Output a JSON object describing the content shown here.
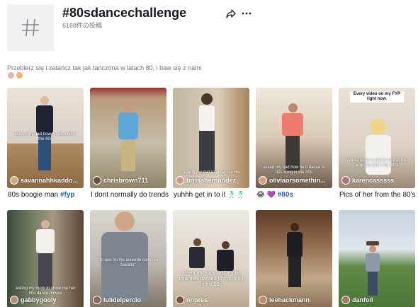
{
  "header": {
    "title": "#80sdancechallenge",
    "post_count": "6168件の投稿",
    "icons": {
      "hashtag": "hashtag-icon",
      "share": "share-icon",
      "more": "more-icon"
    }
  },
  "description": {
    "text": "Przebierz się i zatańcz tak jak tańczona w latach 80, i baw się z nami"
  },
  "videos": [
    {
      "author": "savannahhkaddo...",
      "overlay": "asking my dad how he danced in the 80s",
      "caption": "80s boogie man ",
      "caption_tag": "#fyp"
    },
    {
      "author": "chrisbrown711",
      "overlay": "",
      "caption": "I dont normally do trends",
      "caption_tag": ""
    },
    {
      "author": "brrisahernandez",
      "overlay": "asking my dad to show me his",
      "caption": "yuhhh get in to it 🕺🕺",
      "caption_tag": ""
    },
    {
      "author": "oliviaorsomethin...",
      "overlay": "asked my dad how he'd dance to this song in the 80s",
      "caption": "😂 💜 ",
      "caption_tag": "#80s"
    },
    {
      "author": "karencasssss",
      "overlay": "Every video on my FYP right now.",
      "overlay2": "Asked Mom to dance to this the way she did in the 80's",
      "caption": "Pics of her from the 80's",
      "caption_tag": ""
    },
    {
      "author": "gabbygooly",
      "overlay": "asking my mom to show me her 80s dance moves",
      "caption": "",
      "caption_tag": ""
    },
    {
      "author": "lulidelpercio",
      "overlay": "\"Si que no me acuerdo como se bailaba\"",
      "caption": "",
      "caption_tag": ""
    },
    {
      "author": "nnpres",
      "overlay": "asked my mom and auntie how they danced to this song in the 80s",
      "caption": "",
      "caption_tag": ""
    },
    {
      "author": "leehackmann",
      "overlay": "",
      "caption": "",
      "caption_tag": ""
    },
    {
      "author": "danfoil",
      "overlay": "",
      "caption": "",
      "caption_tag": ""
    }
  ],
  "colors": {
    "accent_link": "#2b5db9",
    "muted": "#73747b",
    "text": "#161823"
  }
}
